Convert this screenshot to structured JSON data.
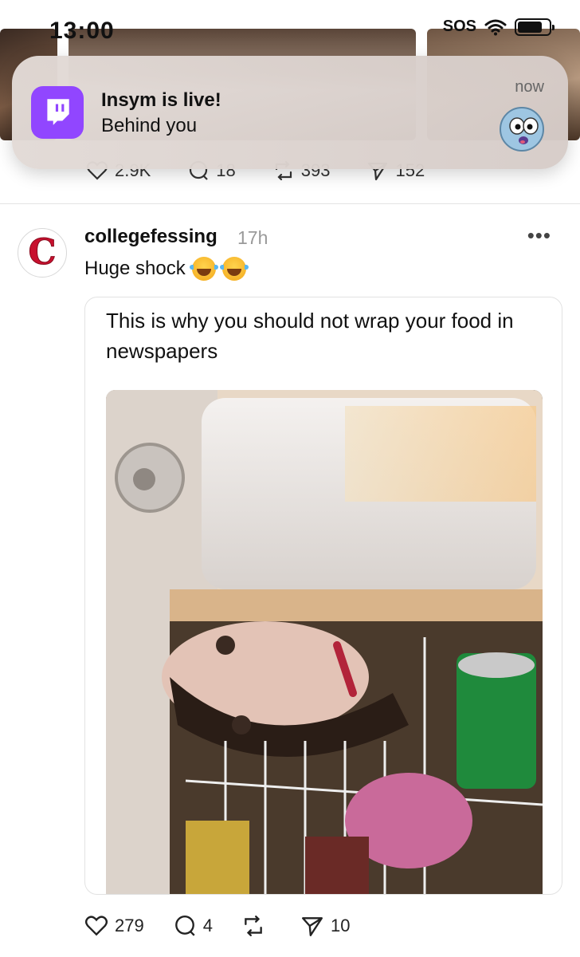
{
  "status_bar": {
    "time": "13:00",
    "carrier": "SOS",
    "battery_level": 0.8
  },
  "notification": {
    "app_icon": "twitch-icon",
    "title": "Insym is live!",
    "body": "Behind you",
    "time": "now",
    "avatar": "shocked-emoji-avatar"
  },
  "previous_post": {
    "actions": {
      "likes": "2.9K",
      "replies": "18",
      "reposts": "393",
      "shares": "152"
    }
  },
  "post": {
    "avatar_letter": "C",
    "username": "collegefessing",
    "time": "17h",
    "more": "•••",
    "text": "Huge shock",
    "emojis": [
      "face-with-tears-of-joy",
      "face-with-tears-of-joy"
    ],
    "quote": {
      "text": "This is why you should not wrap your food in newspapers",
      "image": "fridge-photo-with-clown-face-newspaper"
    },
    "actions": {
      "likes": "279",
      "replies": "4",
      "reposts": "",
      "shares": "10"
    }
  },
  "colors": {
    "twitch_purple": "#9146ff",
    "brand_red": "#c8102e",
    "muted_gray": "#9a9a9a"
  }
}
